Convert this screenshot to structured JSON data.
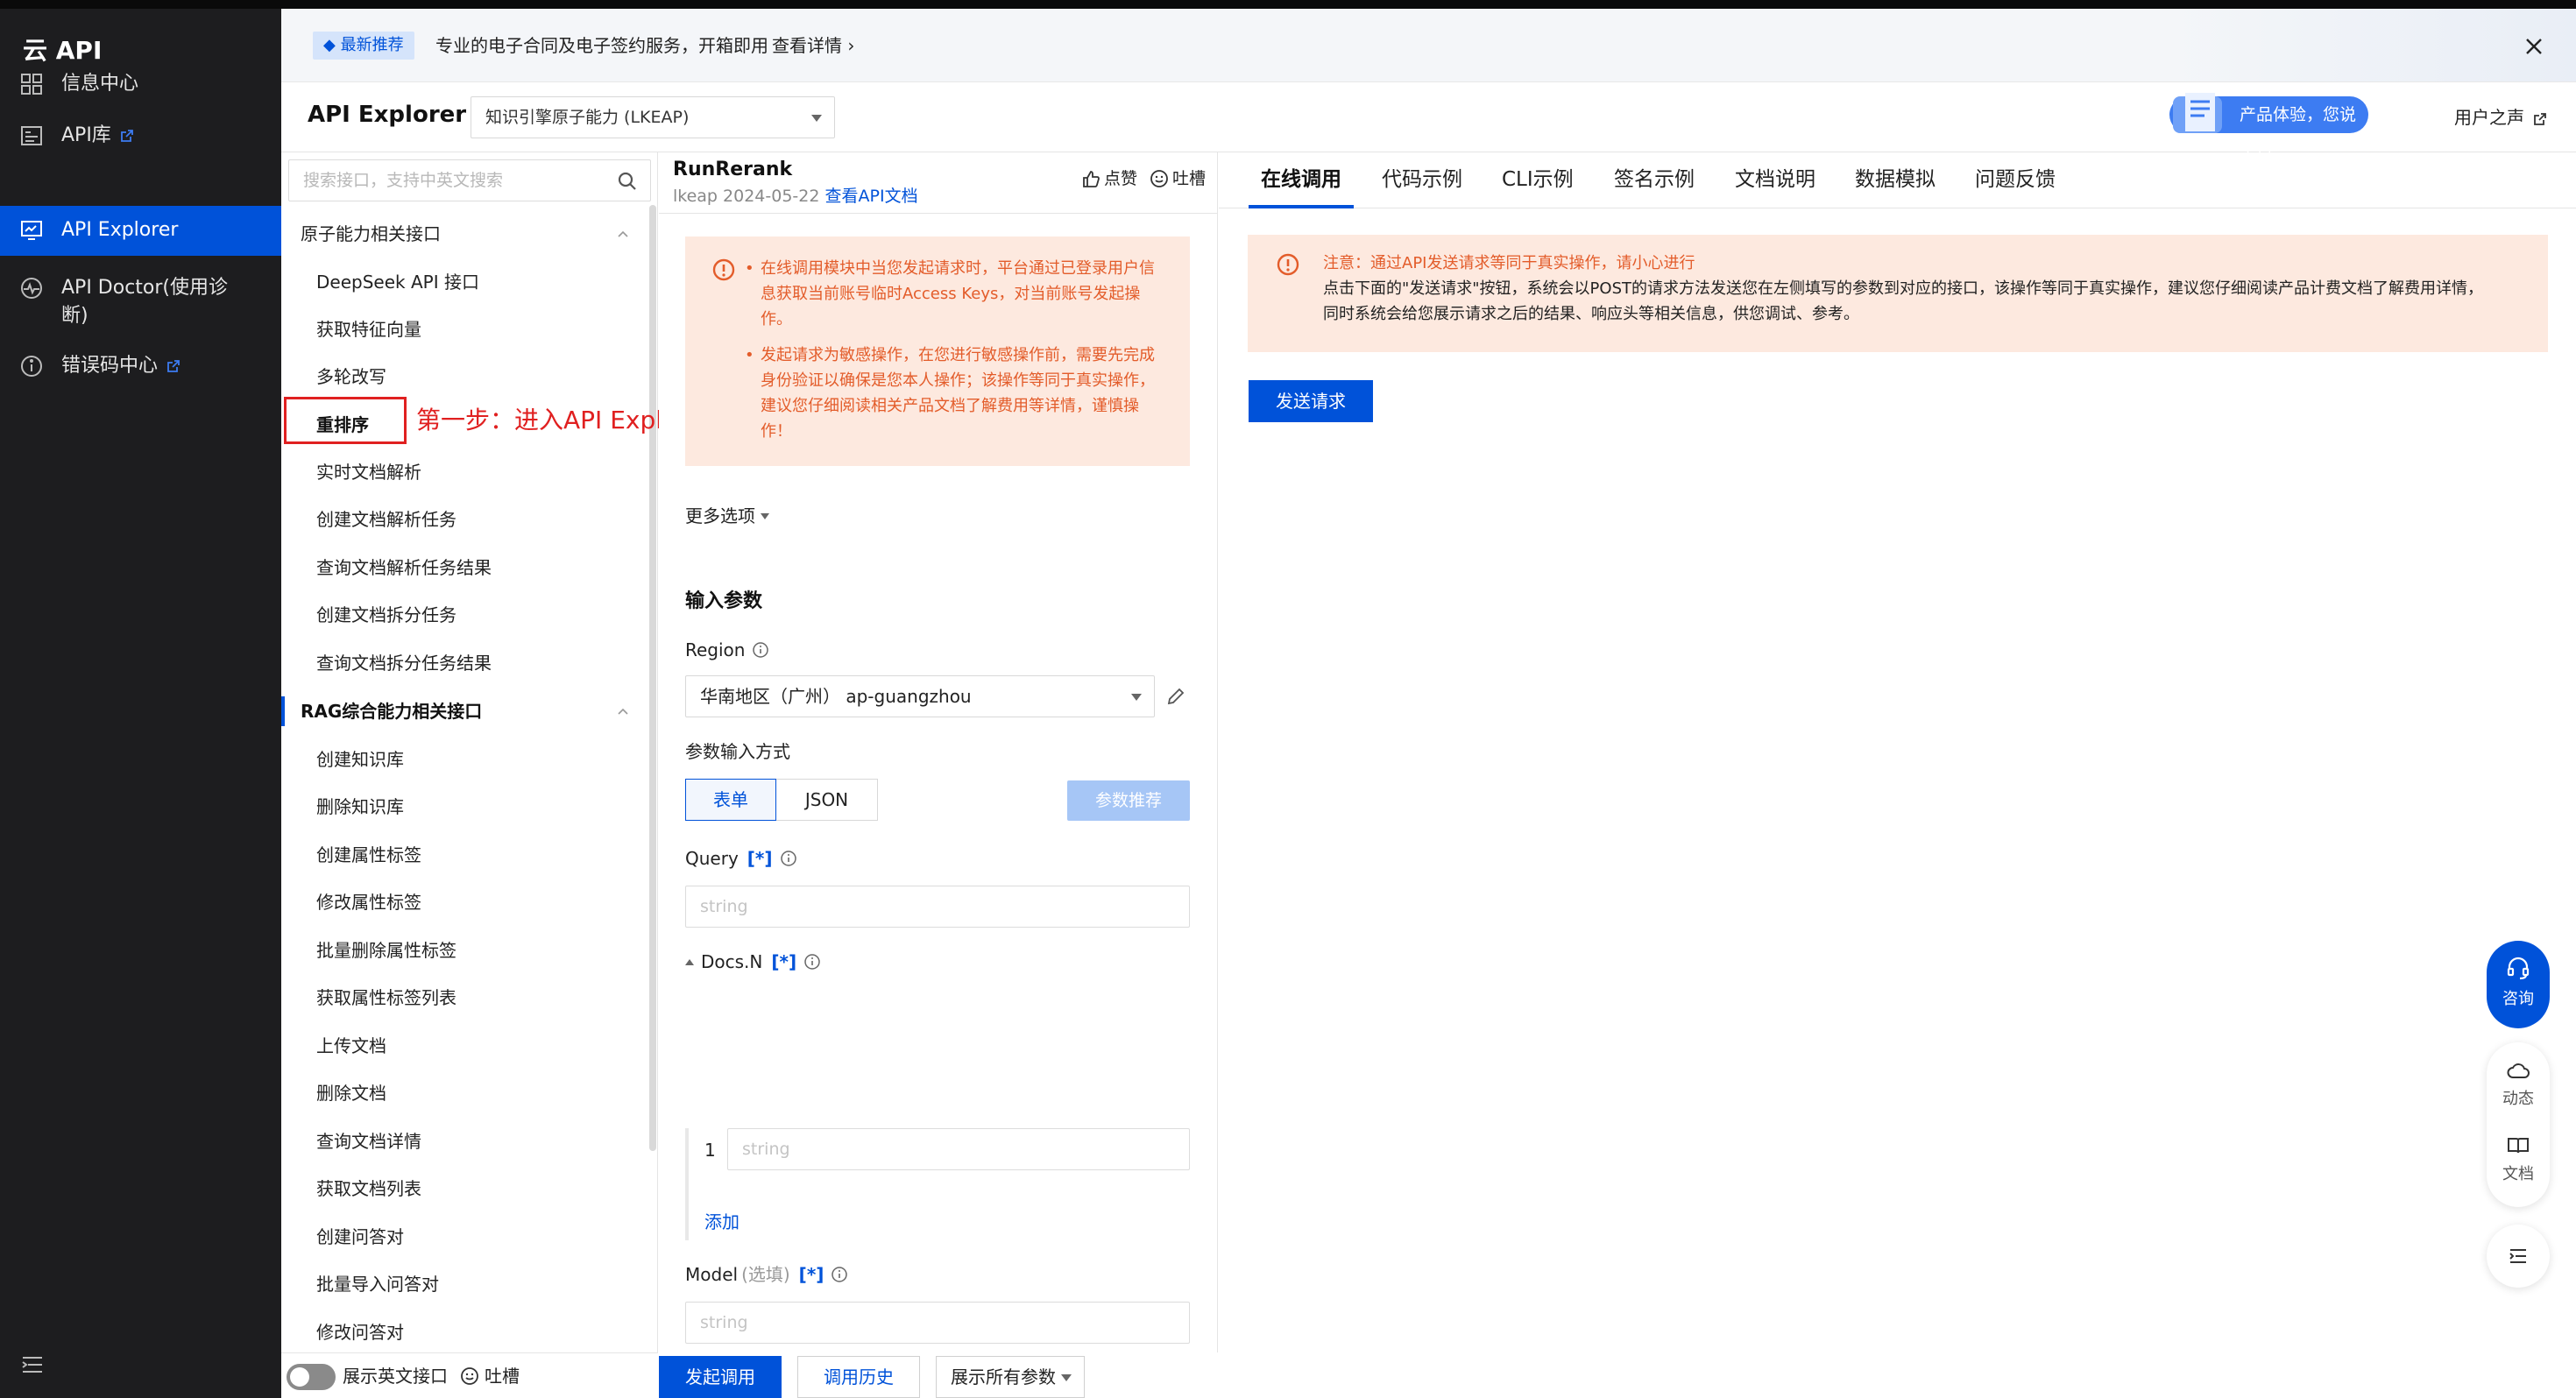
{
  "brand": {
    "logo": "云 API"
  },
  "nav": {
    "items": [
      {
        "label": "信息中心",
        "icon": "grid-icon",
        "external": false,
        "active": false
      },
      {
        "label": "API库",
        "icon": "list-icon",
        "external": true,
        "active": false
      },
      {
        "label": "API Explorer",
        "icon": "monitor-icon",
        "external": false,
        "active": true
      },
      {
        "label": "API Doctor(使用诊断)",
        "icon": "pulse-icon",
        "external": false,
        "active": false
      },
      {
        "label": "错误码中心",
        "icon": "info-circle-icon",
        "external": true,
        "active": false
      }
    ]
  },
  "banner": {
    "badge": "最新推荐",
    "text": "专业的电子合同及电子签约服务，开箱即用",
    "link": "查看详情"
  },
  "header": {
    "title": "API Explorer",
    "product": "知识引擎原子能力 (LKEAP)",
    "feedback": "产品体验，您说了算",
    "user_voice": "用户之声"
  },
  "sidebar": {
    "search_placeholder": "搜索接口，支持中英文搜索",
    "group1": "原子能力相关接口",
    "group1_items": [
      "DeepSeek API 接口",
      "获取特征向量",
      "多轮改写",
      "重排序",
      "实时文档解析",
      "创建文档解析任务",
      "查询文档解析任务结果",
      "创建文档拆分任务",
      "查询文档拆分任务结果"
    ],
    "group2": "RAG综合能力相关接口",
    "group2_items": [
      "创建知识库",
      "删除知识库",
      "创建属性标签",
      "修改属性标签",
      "批量删除属性标签",
      "获取属性标签列表",
      "上传文档",
      "删除文档",
      "查询文档详情",
      "获取文档列表",
      "创建问答对",
      "批量导入问答对",
      "修改问答对"
    ],
    "selected": "重排序",
    "annotation": "第一步：进入API Explorer",
    "footer_toggle": "展示英文接口",
    "footer_tucao": "吐槽"
  },
  "middle": {
    "api_name": "RunRerank",
    "api_version": "lkeap 2024-05-22",
    "api_doc_link": "查看API文档",
    "like": "点赞",
    "tucao": "吐槽",
    "warnings": [
      "在线调用模块中当您发起请求时，平台通过已登录用户信息获取当前账号临时Access Keys，对当前账号发起操作。",
      "发起请求为敏感操作，在您进行敏感操作前，需要先完成身份验证以确保是您本人操作；该操作等同于真实操作，建议您仔细阅读相关产品文档了解费用等详情，谨慎操作！"
    ],
    "more_options": "更多选项",
    "section_title": "输入参数",
    "region_label": "Region",
    "region_value": "华南地区（广州） ap-guangzhou",
    "input_mode_label": "参数输入方式",
    "mode_form": "表单",
    "mode_json": "JSON",
    "recommend": "参数推荐",
    "query_label": "Query",
    "required_mark": "[*]",
    "string_placeholder": "string",
    "docs_label": "Docs.N",
    "docs_index": "1",
    "add": "添加",
    "model_label": "Model",
    "optional": "(选填)",
    "send_btn": "发起调用",
    "history_btn": "调用历史",
    "show_params": "展示所有参数"
  },
  "right": {
    "tabs": [
      "在线调用",
      "代码示例",
      "CLI示例",
      "签名示例",
      "文档说明",
      "数据模拟",
      "问题反馈"
    ],
    "notice_title": "注意：通过API发送请求等同于真实操作，请小心进行",
    "notice_body": "点击下面的\"发送请求\"按钮，系统会以POST的请求方法发送您在左侧填写的参数到对应的接口，该操作等同于真实操作，建议您仔细阅读产品计费文档了解费用详情，同时系统会给您展示请求之后的结果、响应头等相关信息，供您调试、参考。",
    "send": "发送请求"
  },
  "floating": {
    "consult": "咨询",
    "news": "动态",
    "docs": "文档"
  },
  "colors": {
    "primary": "#0052d9",
    "warning_bg": "#fde9df",
    "warning_text": "#e35c2a",
    "nav_bg": "#1d1d1f",
    "annotation": "#e02020"
  }
}
